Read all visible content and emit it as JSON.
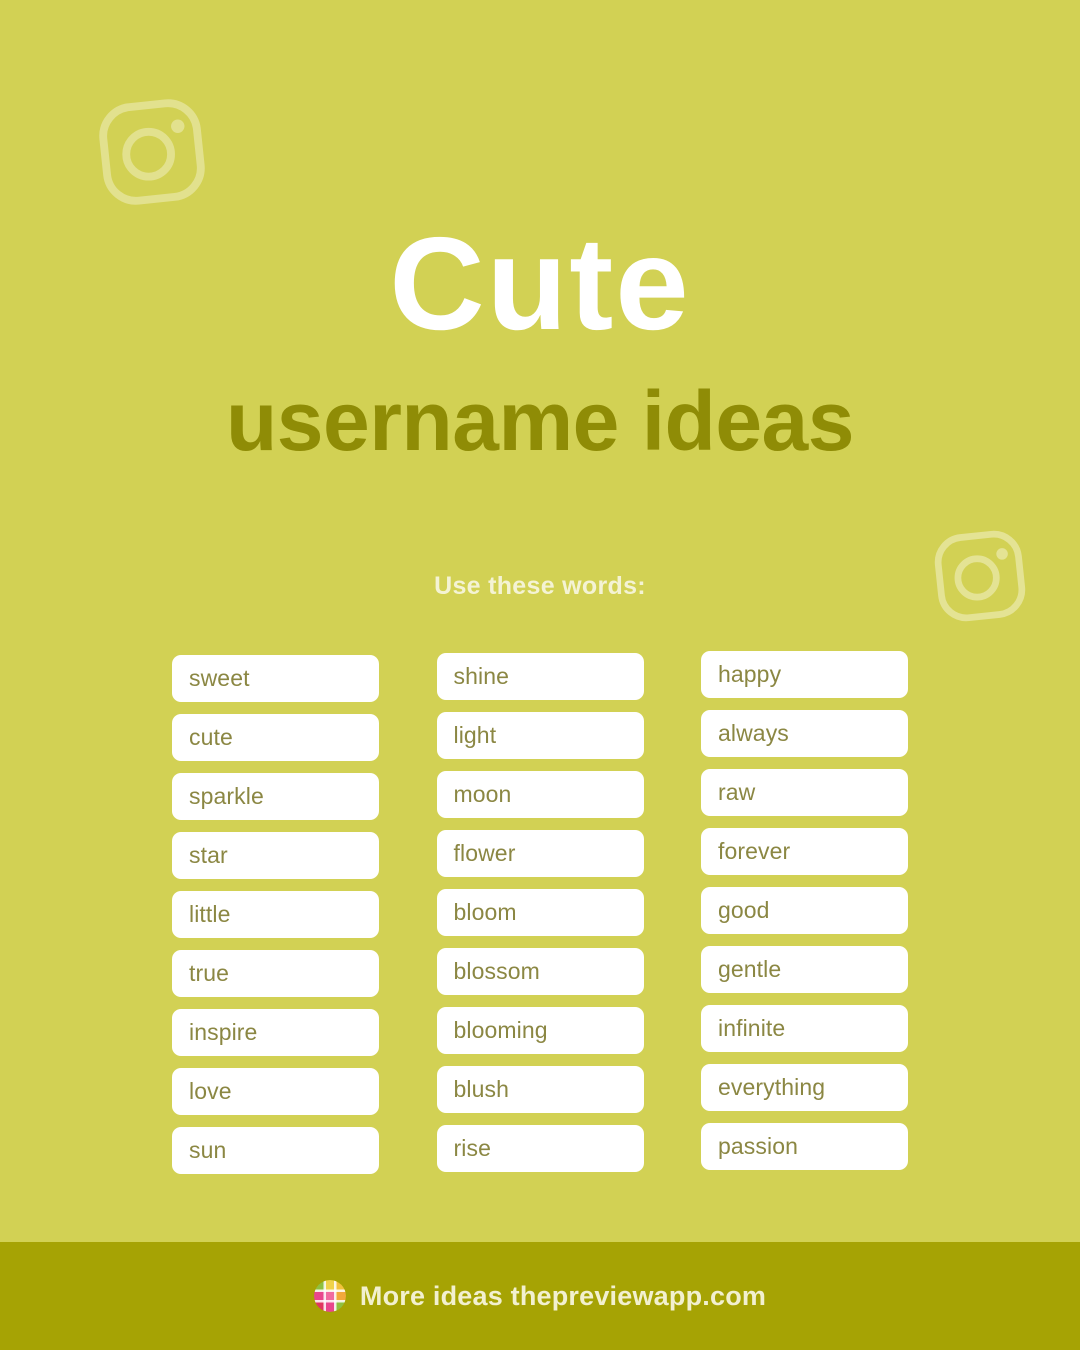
{
  "theme": {
    "background": "#d2d154",
    "title_color": "#ffffff",
    "subtitle_color": "#8f8c06",
    "label_color": "#f4f3d4",
    "chip_background": "#ffffff",
    "chip_text_color": "#8b8743",
    "footer_background": "#a6a304",
    "footer_text_color": "#f2f0cf",
    "icon_color": "#e2e18e"
  },
  "header": {
    "title": "Cute",
    "subtitle": "username ideas"
  },
  "instruction": {
    "label": "Use these words:"
  },
  "decorations": [
    {
      "name": "instagram-icon-top-left"
    },
    {
      "name": "instagram-icon-mid-right"
    }
  ],
  "word_columns": [
    {
      "id": "column-1",
      "words": [
        "sweet",
        "cute",
        "sparkle",
        "star",
        "little",
        "true",
        "inspire",
        "love",
        "sun"
      ]
    },
    {
      "id": "column-2",
      "words": [
        "shine",
        "light",
        "moon",
        "flower",
        "bloom",
        "blossom",
        "blooming",
        "blush",
        "rise"
      ]
    },
    {
      "id": "column-3",
      "words": [
        "happy",
        "always",
        "raw",
        "forever",
        "good",
        "gentle",
        "infinite",
        "everything",
        "passion"
      ]
    }
  ],
  "footer": {
    "logo": "preview-app-grid-logo",
    "text": "More ideas thepreviewapp.com"
  }
}
